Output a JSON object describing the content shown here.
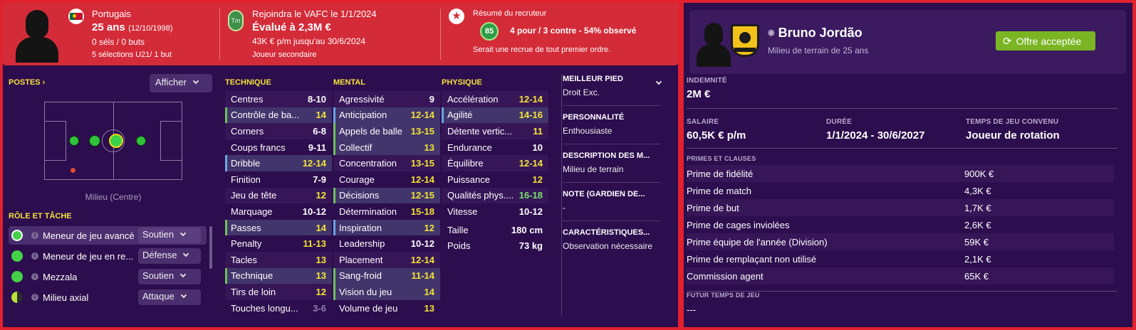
{
  "player_header": {
    "nationality": "Portugais",
    "age": "25 ans",
    "birthdate": "(12/10/1998)",
    "selections": "0 séls / 0 buts",
    "u21": "5 sélections U21/ 1 but",
    "joined": "Rejoindra le VAFC le 1/1/2024",
    "tm_badge": "Tm",
    "valuation": "Évalué à 2,3M €",
    "wage": "43K € p/m jusqu'au 30/6/2024",
    "status": "Joueur secondaire",
    "scout_title": "Résumé du recruteur",
    "scout_score": "85",
    "scout_summary": "4 pour / 3 contre - 54% observé",
    "scout_note": "Serait une recrue de tout premier ordre."
  },
  "positions": {
    "title": "POSTES",
    "show_button": "Afficher",
    "pitch_label": "Milieu (Centre)"
  },
  "roles": {
    "title": "RÔLE ET TÂCHE",
    "items": [
      {
        "name": "Meneur de jeu avancé",
        "duty": "Soutien",
        "dot": "#44d049"
      },
      {
        "name": "Meneur de jeu en re...",
        "duty": "Défense",
        "dot": "#44d049"
      },
      {
        "name": "Mezzala",
        "duty": "Soutien",
        "dot": "#44d049"
      },
      {
        "name": "Milieu axial",
        "duty": "Attaque",
        "dot": "#b8e23a"
      }
    ]
  },
  "attributes": {
    "technique": {
      "title": "TECHNIQUE",
      "rows": [
        {
          "name": "Centres",
          "value": "8-10",
          "cls": "",
          "vc": ""
        },
        {
          "name": "Contrôle de ba...",
          "value": "14",
          "cls": "hl g",
          "vc": "y"
        },
        {
          "name": "Corners",
          "value": "6-8",
          "cls": "",
          "vc": ""
        },
        {
          "name": "Coups francs",
          "value": "9-11",
          "cls": "",
          "vc": ""
        },
        {
          "name": "Dribble",
          "value": "12-14",
          "cls": "hl b",
          "vc": "y"
        },
        {
          "name": "Finition",
          "value": "7-9",
          "cls": "",
          "vc": ""
        },
        {
          "name": "Jeu de tête",
          "value": "12",
          "cls": "",
          "vc": "y"
        },
        {
          "name": "Marquage",
          "value": "10-12",
          "cls": "",
          "vc": ""
        },
        {
          "name": "Passes",
          "value": "14",
          "cls": "hl g",
          "vc": "y"
        },
        {
          "name": "Penalty",
          "value": "11-13",
          "cls": "",
          "vc": "y"
        },
        {
          "name": "Tacles",
          "value": "13",
          "cls": "",
          "vc": "y"
        },
        {
          "name": "Technique",
          "value": "13",
          "cls": "hl g",
          "vc": "y"
        },
        {
          "name": "Tirs de loin",
          "value": "12",
          "cls": "",
          "vc": "y"
        },
        {
          "name": "Touches longu...",
          "value": "3-6",
          "cls": "",
          "vc": "dim"
        }
      ]
    },
    "mental": {
      "title": "MENTAL",
      "rows": [
        {
          "name": "Agressivité",
          "value": "9",
          "cls": "",
          "vc": ""
        },
        {
          "name": "Anticipation",
          "value": "12-14",
          "cls": "hl b",
          "vc": "y"
        },
        {
          "name": "Appels de balle",
          "value": "13-15",
          "cls": "hl g",
          "vc": "y"
        },
        {
          "name": "Collectif",
          "value": "13",
          "cls": "hl g",
          "vc": "y"
        },
        {
          "name": "Concentration",
          "value": "13-15",
          "cls": "",
          "vc": "y"
        },
        {
          "name": "Courage",
          "value": "12-14",
          "cls": "",
          "vc": "y"
        },
        {
          "name": "Décisions",
          "value": "12-15",
          "cls": "hl g",
          "vc": "y"
        },
        {
          "name": "Détermination",
          "value": "15-18",
          "cls": "",
          "vc": "y"
        },
        {
          "name": "Inspiration",
          "value": "12",
          "cls": "hl b",
          "vc": "y"
        },
        {
          "name": "Leadership",
          "value": "10-12",
          "cls": "",
          "vc": ""
        },
        {
          "name": "Placement",
          "value": "12-14",
          "cls": "",
          "vc": "y"
        },
        {
          "name": "Sang-froid",
          "value": "11-14",
          "cls": "hl g",
          "vc": "y"
        },
        {
          "name": "Vision du jeu",
          "value": "14",
          "cls": "hl g",
          "vc": "y"
        },
        {
          "name": "Volume de jeu",
          "value": "13",
          "cls": "",
          "vc": "y"
        }
      ]
    },
    "physique": {
      "title": "PHYSIQUE",
      "rows": [
        {
          "name": "Accélération",
          "value": "12-14",
          "cls": "",
          "vc": "y"
        },
        {
          "name": "Agilité",
          "value": "14-16",
          "cls": "hl b",
          "vc": "y"
        },
        {
          "name": "Détente vertic...",
          "value": "11",
          "cls": "",
          "vc": "y"
        },
        {
          "name": "Endurance",
          "value": "10",
          "cls": "",
          "vc": ""
        },
        {
          "name": "Équilibre",
          "value": "12-14",
          "cls": "",
          "vc": "y"
        },
        {
          "name": "Puissance",
          "value": "12",
          "cls": "",
          "vc": "y"
        },
        {
          "name": "Qualités phys....",
          "value": "16-18",
          "cls": "",
          "vc": "gr"
        },
        {
          "name": "Vitesse",
          "value": "10-12",
          "cls": "",
          "vc": ""
        }
      ],
      "height_label": "Taille",
      "height": "180 cm",
      "weight_label": "Poids",
      "weight": "73 kg"
    }
  },
  "info": {
    "foot_title": "MEILLEUR PIED",
    "foot": "Droit Exc.",
    "personality_title": "PERSONNALITÉ",
    "personality": "Enthousiaste",
    "desc_title": "DESCRIPTION DES M...",
    "desc": "Milieu de terrain",
    "gk_title": "NOTE (GARDIEN DE...",
    "gk": "-",
    "chars_title": "CARACTÉRISTIQUES...",
    "chars": "Observation nécessaire"
  },
  "offer": {
    "player_name": "Bruno Jordão",
    "player_sub": "Milieu de terrain de 25 ans",
    "accepted_button": "Offre acceptée",
    "fee_label": "INDEMNITÉ",
    "fee": "2M €",
    "salary_label": "SALAIRE",
    "salary": "60,5K € p/m",
    "duration_label": "DURÉE",
    "duration": "1/1/2024 - 30/6/2027",
    "playtime_label": "TEMPS DE JEU CONVENU",
    "playtime": "Joueur de rotation",
    "bonus_title": "PRIMES ET CLAUSES",
    "bonuses": [
      {
        "name": "Prime de fidélité",
        "value": "900K €"
      },
      {
        "name": "Prime de match",
        "value": "4,3K €"
      },
      {
        "name": "Prime de but",
        "value": "1,7K €"
      },
      {
        "name": "Prime de cages inviolées",
        "value": "2,6K €"
      },
      {
        "name": "Prime équipe de l'année (Division)",
        "value": "59K €"
      },
      {
        "name": "Prime de remplaçant non utilisé",
        "value": "2,1K €"
      },
      {
        "name": "Commission agent",
        "value": "65K €"
      }
    ],
    "future_title": "FUTUR TEMPS DE JEU",
    "future": "---"
  }
}
